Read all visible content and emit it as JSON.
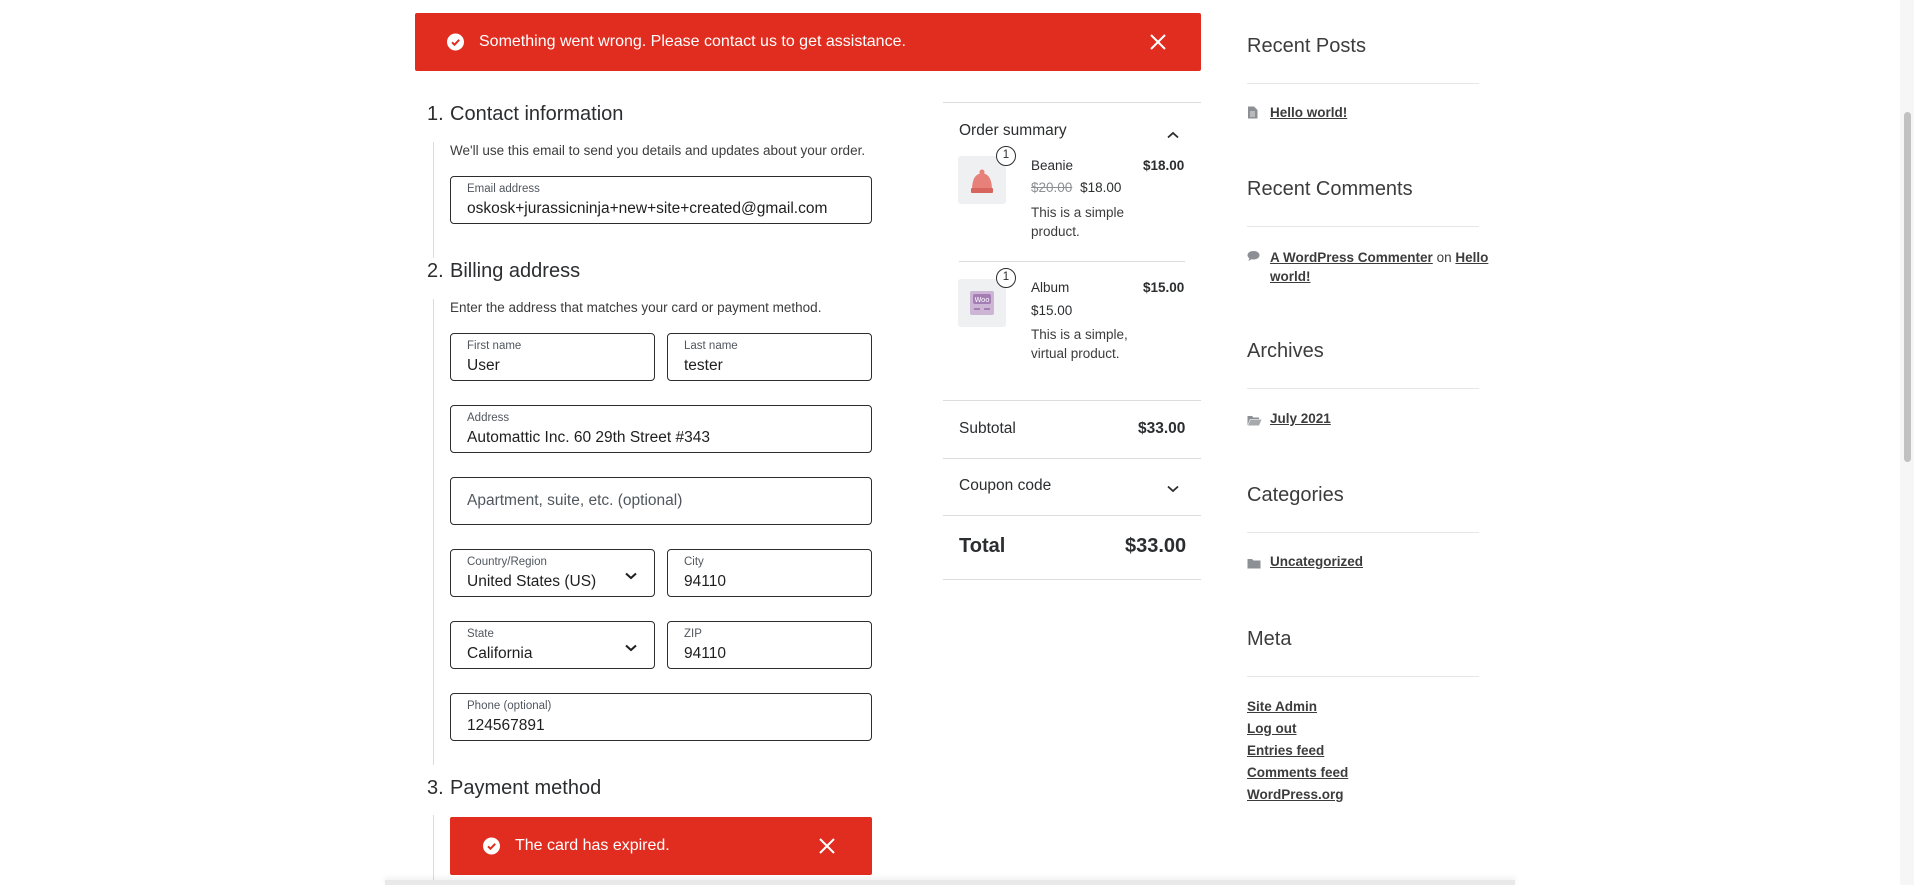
{
  "top_notice": {
    "text": "Something went wrong. Please contact us to get assistance."
  },
  "contact": {
    "number": "1.",
    "title": "Contact information",
    "description": "We'll use this email to send you details and updates about your order.",
    "email_label": "Email address",
    "email_value": "oskosk+jurassicninja+new+site+created@gmail.com"
  },
  "billing": {
    "number": "2.",
    "title": "Billing address",
    "description": "Enter the address that matches your card or payment method.",
    "first_name_label": "First name",
    "first_name_value": "User",
    "last_name_label": "Last name",
    "last_name_value": "tester",
    "address_label": "Address",
    "address_value": "Automattic Inc. 60 29th Street #343",
    "apartment_placeholder": "Apartment, suite, etc. (optional)",
    "country_label": "Country/Region",
    "country_value": "United States (US)",
    "city_label": "City",
    "city_value": "94110",
    "state_label": "State",
    "state_value": "California",
    "zip_label": "ZIP",
    "zip_value": "94110",
    "phone_label": "Phone (optional)",
    "phone_value": "124567891"
  },
  "payment": {
    "number": "3.",
    "title": "Payment method",
    "notice": "The card has expired."
  },
  "summary": {
    "title": "Order summary",
    "items": [
      {
        "qty": "1",
        "name": "Beanie",
        "total": "$18.00",
        "regular_price": "$20.00",
        "sale_price": "$18.00",
        "desc_line1": "This is a simple",
        "desc_line2": "product.",
        "icon": "beanie-thumbnail"
      },
      {
        "qty": "1",
        "name": "Album",
        "total": "$15.00",
        "price": "$15.00",
        "desc_line1": "This is a simple,",
        "desc_line2": "virtual product.",
        "icon": "album-thumbnail"
      }
    ],
    "subtotal_label": "Subtotal",
    "subtotal_value": "$33.00",
    "coupon_label": "Coupon code",
    "total_label": "Total",
    "total_value": "$33.00"
  },
  "sidebar": {
    "recent_posts_title": "Recent Posts",
    "recent_posts": [
      "Hello world!"
    ],
    "recent_comments_title": "Recent Comments",
    "comment_author": "A WordPress Commenter",
    "comment_on": "on",
    "comment_post_line1": "Hello",
    "comment_post_line2": "world!",
    "archives_title": "Archives",
    "archives": [
      "July 2021"
    ],
    "categories_title": "Categories",
    "categories": [
      "Uncategorized"
    ],
    "meta_title": "Meta",
    "meta_links": [
      "Site Admin",
      "Log out",
      "Entries feed",
      "Comments feed",
      "WordPress.org"
    ]
  },
  "colors": {
    "error": "#e12d1f",
    "text": "#2b2d2f",
    "border": "#2b2d2f"
  }
}
